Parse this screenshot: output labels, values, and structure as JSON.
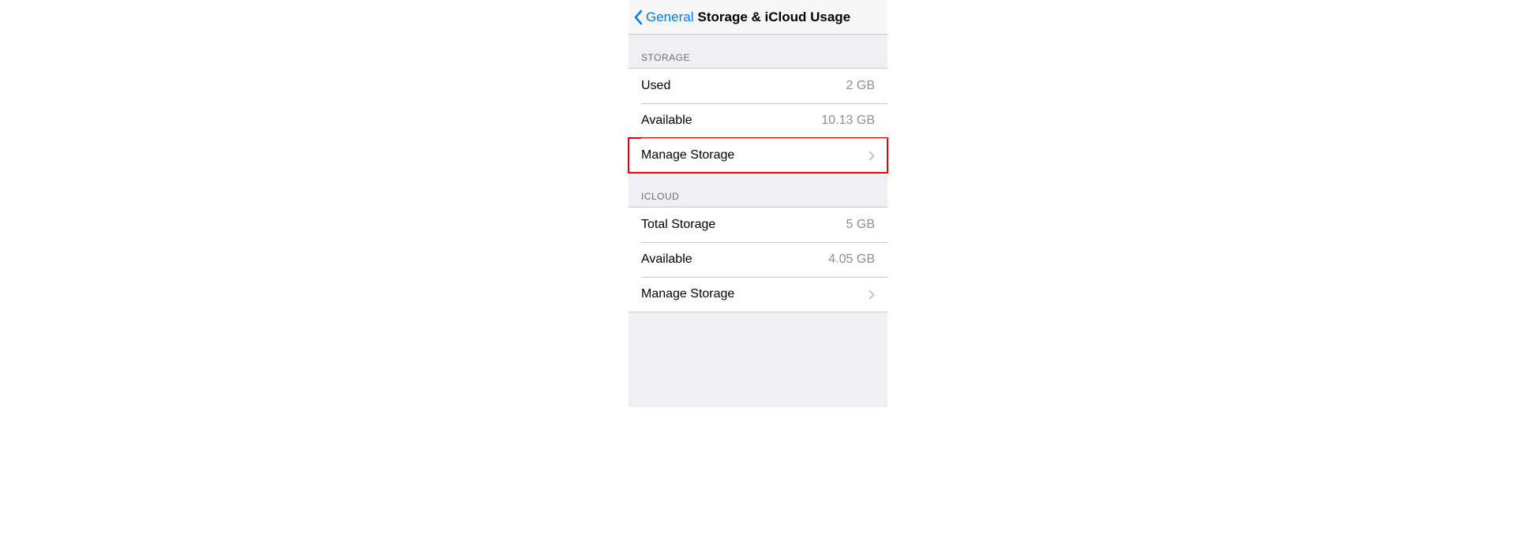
{
  "nav": {
    "back_label": "General",
    "title": "Storage & iCloud Usage"
  },
  "sections": {
    "storage": {
      "header": "Storage",
      "used_label": "Used",
      "used_value": "2 GB",
      "available_label": "Available",
      "available_value": "10.13 GB",
      "manage_label": "Manage Storage"
    },
    "icloud": {
      "header": "iCloud",
      "total_label": "Total Storage",
      "total_value": "5 GB",
      "available_label": "Available",
      "available_value": "4.05 GB",
      "manage_label": "Manage Storage"
    }
  }
}
